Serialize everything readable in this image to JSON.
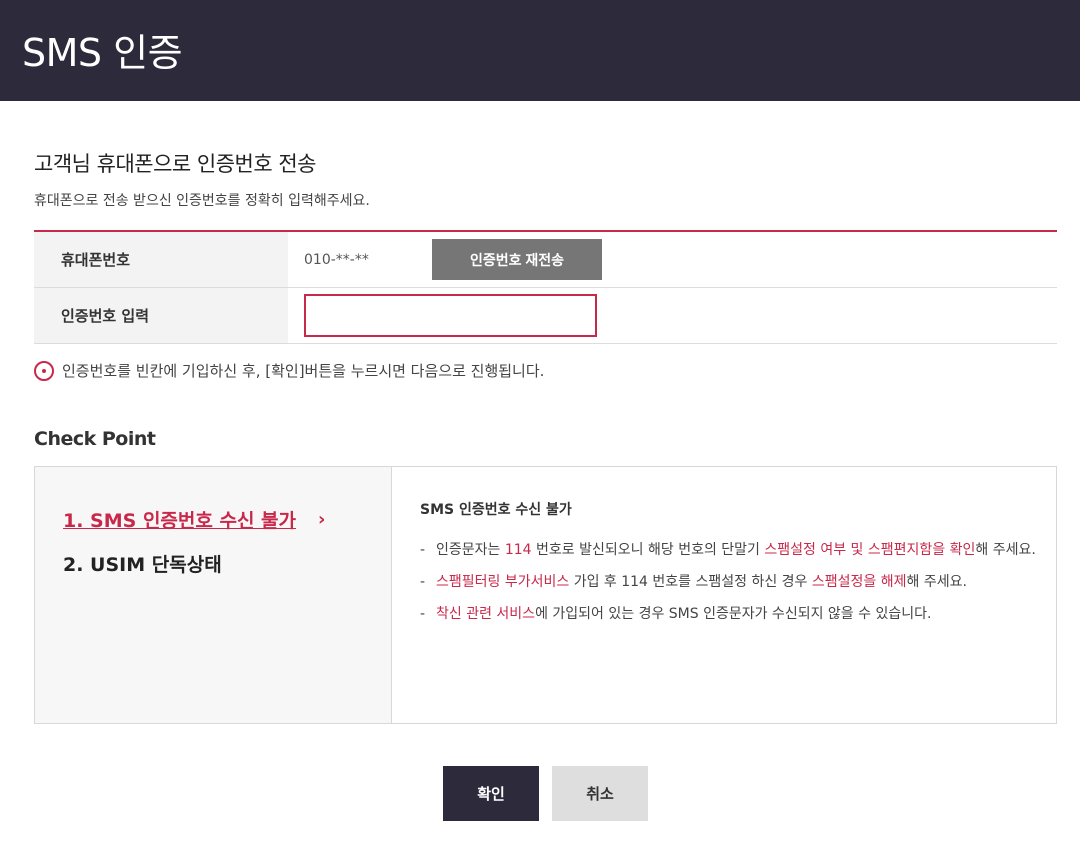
{
  "header": {
    "title": "SMS 인증"
  },
  "section": {
    "title": "고객님 휴대폰으로 인증번호 전송",
    "description": "휴대폰으로 전송 받으신 인증번호를 정확히 입력해주세요."
  },
  "form": {
    "phone_label": "휴대폰번호",
    "phone_value": "010-**-**",
    "resend_label": "인증번호 재전송",
    "code_label": "인증번호 입력",
    "code_value": ""
  },
  "notice": {
    "text": "인증번호를 빈칸에 기입하신 후, [확인]버튼을 누르시면 다음으로 진행됩니다."
  },
  "checkpoint": {
    "title": "Check Point",
    "nav": [
      {
        "label": "1. SMS 인증번호 수신 불가",
        "active": true
      },
      {
        "label": "2. USIM 단독상태",
        "active": false
      }
    ],
    "content_title": "SMS 인증번호 수신 불가",
    "bullets": [
      {
        "dash": "-",
        "segments": [
          {
            "text": "인증문자는 ",
            "red": false
          },
          {
            "text": "114",
            "red": true
          },
          {
            "text": " 번호로 발신되오니 해당 번호의 단말기 ",
            "red": false
          },
          {
            "text": "스팸설정 여부 및 스팸편지함을 확인",
            "red": true
          },
          {
            "text": "해 주세요.",
            "red": false
          }
        ]
      },
      {
        "dash": "-",
        "segments": [
          {
            "text": "스팸필터링 부가서비스",
            "red": true
          },
          {
            "text": " 가입 후 114 번호를 스팸설정 하신 경우 ",
            "red": false
          },
          {
            "text": "스팸설정을 해제",
            "red": true
          },
          {
            "text": "해 주세요.",
            "red": false
          }
        ]
      },
      {
        "dash": "-",
        "segments": [
          {
            "text": "착신 관련 서비스",
            "red": true
          },
          {
            "text": "에 가입되어 있는 경우 SMS 인증문자가 수신되지 않을 수 있습니다.",
            "red": false
          }
        ]
      }
    ]
  },
  "buttons": {
    "confirm": "확인",
    "cancel": "취소"
  },
  "colors": {
    "header_bg": "#2d2a3c",
    "accent": "#c8284a",
    "resend_bg": "#767676",
    "cancel_bg": "#dedede"
  }
}
